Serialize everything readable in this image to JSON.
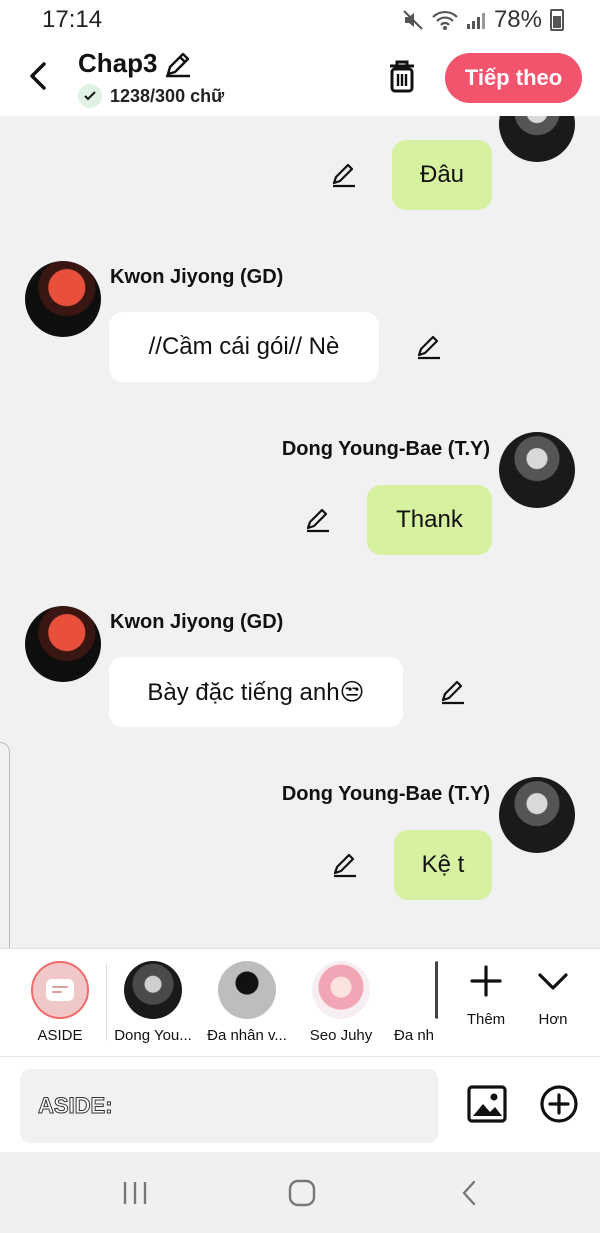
{
  "status": {
    "time": "17:14",
    "battery": "78%"
  },
  "header": {
    "title": "Chap3",
    "word_count": "1238/300 chữ",
    "next_label": "Tiếp theo",
    "accent": "#f2546e"
  },
  "messages": [
    {
      "side": "right",
      "sender": "",
      "text": "Đâu"
    },
    {
      "side": "left",
      "sender": "Kwon Jiyong (GD)",
      "text": "//Cầm cái gói// Nè"
    },
    {
      "side": "right",
      "sender": "Dong Young-Bae (T.Y)",
      "text": "Thank"
    },
    {
      "side": "left",
      "sender": "Kwon Jiyong (GD)",
      "text": "Bày đặc tiếng anh😒"
    },
    {
      "side": "right",
      "sender": "Dong Young-Bae (T.Y)",
      "text": "Kệ t"
    }
  ],
  "characters": [
    {
      "label": "ASIDE"
    },
    {
      "label": "Dong You..."
    },
    {
      "label": "Đa nhân v..."
    },
    {
      "label": "Seo Juhy"
    },
    {
      "label": "Đa nh"
    }
  ],
  "tools": {
    "add_label": "Thêm",
    "more_label": "Hơn"
  },
  "input": {
    "placeholder": "ASIDE:"
  },
  "colors": {
    "bubble_self": "#d6f1a0",
    "bubble_other": "#ffffff",
    "background": "#f1f1f1"
  }
}
